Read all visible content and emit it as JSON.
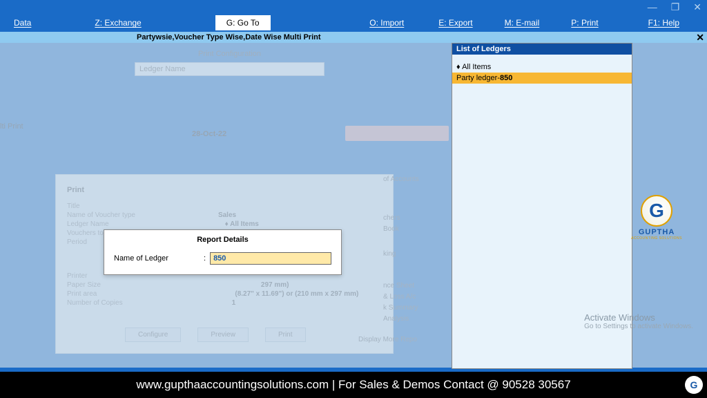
{
  "titlebar": {
    "minimize": "—",
    "restore": "❐",
    "close": "✕"
  },
  "menu": {
    "data": "Data",
    "exchange": "Z: Exchange",
    "goto": "G: Go To",
    "import": "O: Import",
    "export": "E: Export",
    "email": "M: E-mail",
    "print": "P: Print",
    "help": "F1: Help"
  },
  "header": {
    "title": "Partywsie,Voucher Type Wise,Date Wise Multi Print",
    "close": "✕"
  },
  "bg": {
    "print_config": "Print Configuration",
    "ledger_name": "Ledger Name",
    "lti_print": "lti Print",
    "date": "28-Oct-22",
    "print_panel": {
      "title": "Print",
      "r1": "Title",
      "r2": "Name of Voucher type",
      "r2v": "Sales",
      "r3": "Ledger Name",
      "r3v": "♦ All Items",
      "r4": "Vouchers to",
      "r5": "Period",
      "r6": "Printer",
      "r7": "Paper Size",
      "r7v": "297 mm)",
      "r8": "Print area",
      "r8v": "(8.27\" x 11.69\") or (210 mm x 297 mm)",
      "r9": "Number of Copies",
      "r9v": "1",
      "btn_configure": "Configure",
      "btn_preview": "Preview",
      "btn_print": "Print"
    },
    "right_col": {
      "l1": "of Accounts",
      "l2": "chers",
      "l3": "Book",
      "l4": "king",
      "l5": "nce Sheet",
      "l6": "& Loss A/c",
      "l7": "k Summary",
      "l8": "Analysis",
      "l9": "Display More Repo"
    }
  },
  "report_dialog": {
    "title": "Report Details",
    "label": "Name of Ledger",
    "value": "850"
  },
  "ledger_list": {
    "title": "List of Ledgers",
    "items": [
      {
        "label": "All Items",
        "diamond": true,
        "selected": false
      },
      {
        "label_prefix": "Party ledger-",
        "label_hl": "850",
        "diamond": false,
        "selected": true
      }
    ]
  },
  "logo": {
    "letter": "G",
    "text": "GUPTHA",
    "sub": "ACCOUNTING SOLUTIONS"
  },
  "activate": {
    "title": "Activate Windows",
    "sub": "Go to Settings to activate Windows."
  },
  "footer": {
    "text": "www.gupthaaccountingsolutions.com | For Sales & Demos Contact @ 90528 30567",
    "logo": "G"
  }
}
